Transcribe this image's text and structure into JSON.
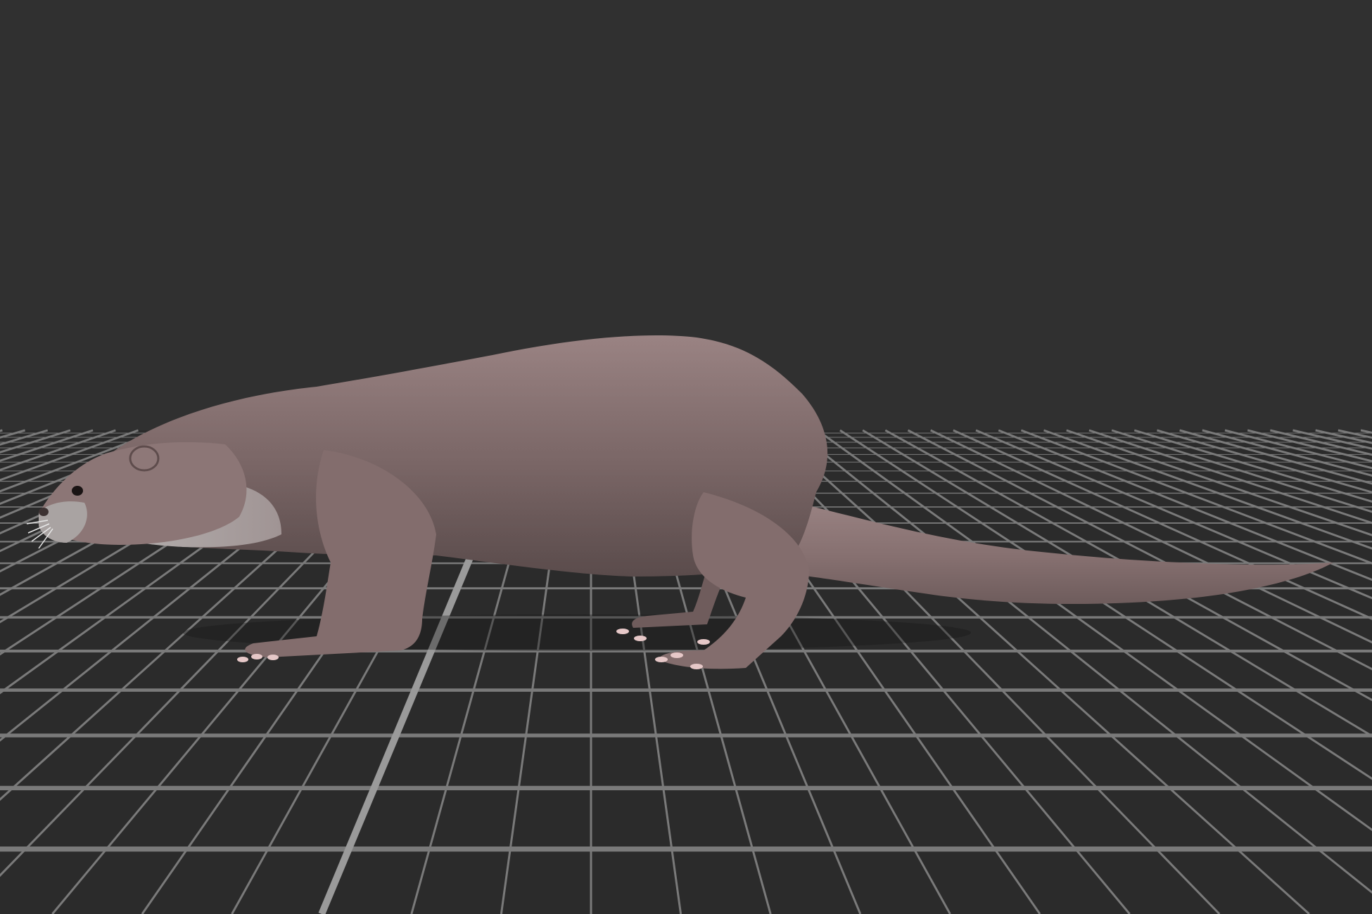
{
  "viewport": {
    "background_color": "#303030",
    "floor_color": "#2b2b2b",
    "grid_line_color": "#7a7a7a",
    "grid_axis_color": "#9a9a9a",
    "model_icon": "otter-model-icon",
    "model_fur_color": "#8a7474",
    "model_throat_color": "#aaa7a6",
    "model_claw_color": "#e6c8c8"
  }
}
